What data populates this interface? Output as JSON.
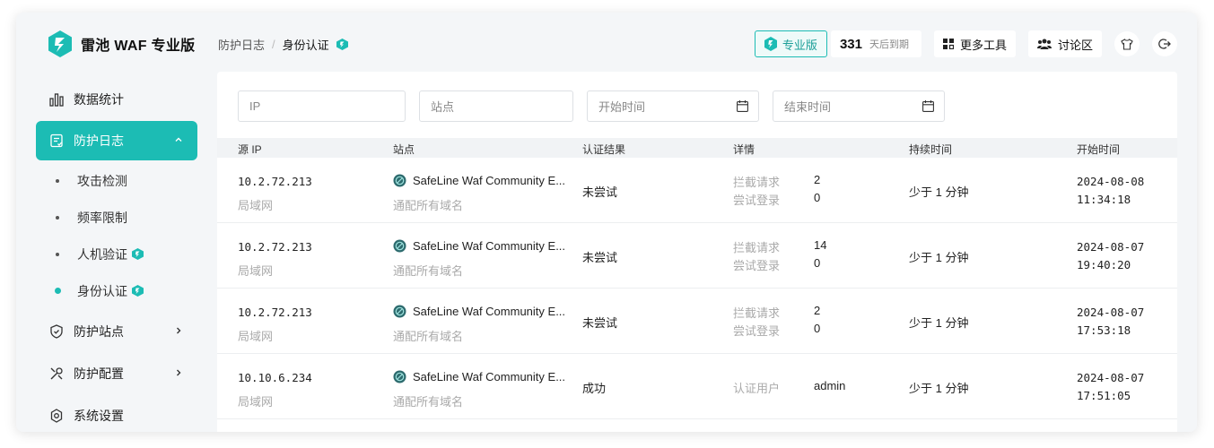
{
  "brand": {
    "name": "雷池 WAF 专业版"
  },
  "nav": {
    "items": [
      {
        "label": "数据统计"
      },
      {
        "label": "防护日志"
      },
      {
        "label": "防护站点"
      },
      {
        "label": "防护配置"
      },
      {
        "label": "系统设置"
      }
    ],
    "sub": [
      {
        "label": "攻击检测"
      },
      {
        "label": "频率限制"
      },
      {
        "label": "人机验证"
      },
      {
        "label": "身份认证"
      }
    ]
  },
  "breadcrumb": {
    "parent": "防护日志",
    "separator": "/",
    "current": "身份认证"
  },
  "topbar": {
    "pro_label": "专业版",
    "days": "331",
    "days_text": "天后到期",
    "more_tools": "更多工具",
    "forum": "讨论区"
  },
  "filters": {
    "ip": "IP",
    "site": "站点",
    "start": "开始时间",
    "end": "结束时间"
  },
  "table": {
    "headers": [
      "源 IP",
      "站点",
      "认证结果",
      "详情",
      "持续时间",
      "开始时间"
    ],
    "rows": [
      {
        "ip": "10.2.72.213",
        "net": "局域网",
        "site": "SafeLine Waf Community E...",
        "site_sub": "通配所有域名",
        "result": "未尝试",
        "d1_label": "拦截请求",
        "d1_value": "2",
        "d2_label": "尝试登录",
        "d2_value": "0",
        "duration": "少于 1 分钟",
        "date": "2024-08-08",
        "time": "11:34:18"
      },
      {
        "ip": "10.2.72.213",
        "net": "局域网",
        "site": "SafeLine Waf Community E...",
        "site_sub": "通配所有域名",
        "result": "未尝试",
        "d1_label": "拦截请求",
        "d1_value": "14",
        "d2_label": "尝试登录",
        "d2_value": "0",
        "duration": "少于 1 分钟",
        "date": "2024-08-07",
        "time": "19:40:20"
      },
      {
        "ip": "10.2.72.213",
        "net": "局域网",
        "site": "SafeLine Waf Community E...",
        "site_sub": "通配所有域名",
        "result": "未尝试",
        "d1_label": "拦截请求",
        "d1_value": "2",
        "d2_label": "尝试登录",
        "d2_value": "0",
        "duration": "少于 1 分钟",
        "date": "2024-08-07",
        "time": "17:53:18"
      },
      {
        "ip": "10.10.6.234",
        "net": "局域网",
        "site": "SafeLine Waf Community E...",
        "site_sub": "通配所有域名",
        "result": "成功",
        "d1_label": "认证用户",
        "d1_value": "admin",
        "duration": "少于 1 分钟",
        "date": "2024-08-07",
        "time": "17:51:05"
      }
    ]
  },
  "colors": {
    "accent": "#1cbcb4",
    "background": "#f4f6f8"
  },
  "icons": [
    "brand-logo-icon",
    "bar-chart-icon",
    "log-icon",
    "shield-icon",
    "tools-icon",
    "gear-icon",
    "pro-icon",
    "grid-icon",
    "users-icon",
    "shirt-icon",
    "logout-icon",
    "calendar-icon",
    "site-globe-icon"
  ]
}
